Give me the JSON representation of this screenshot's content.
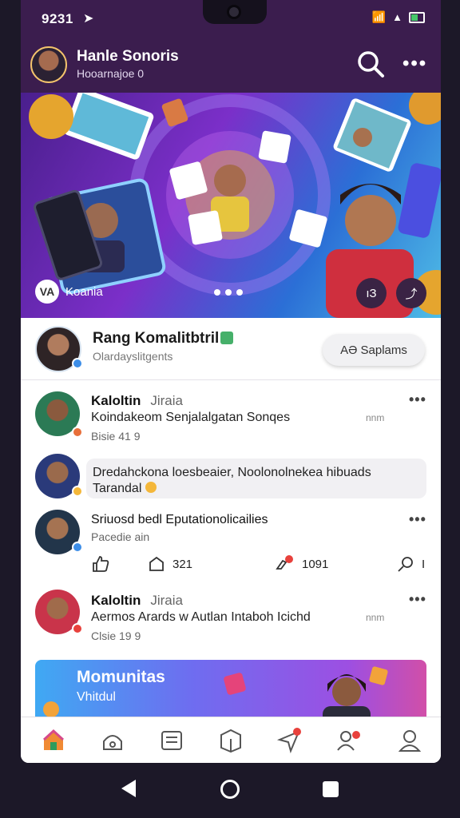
{
  "status_bar": {
    "time": "9231",
    "icons": [
      "location-arrow-icon",
      "wifi-icon",
      "signal-icon",
      "battery-icon"
    ]
  },
  "app_bar": {
    "title": "Hanle Sonoris",
    "subtitle": "Hooarnajoe 0",
    "search_icon": "search-icon",
    "more_icon": "more-icon",
    "more_label": "•••"
  },
  "hero": {
    "badge_logo": "VA",
    "badge_label": "Koania",
    "button_1": "ıЗ",
    "button_2": "⤴"
  },
  "profile_card": {
    "name": "Rang Komalitbtril",
    "subtitle": "Olardayslitgents",
    "button_label": "AƏ Saplams"
  },
  "feed": [
    {
      "name": "Kaloltin",
      "tag": "Jiraia",
      "line": "Koindakeom Senjalalgatan Sonqes",
      "meta": "Bisie 41 9",
      "time": "nnm"
    },
    {
      "bubble": "Dredahckona loesbeaier, Noolonolnekea hibuads",
      "bubble_line2": "Tarandal"
    },
    {
      "name": "Sriuosd bedl Eputationolicailies",
      "meta": "Pacedie ain"
    },
    {
      "name": "Kaloltin",
      "tag": "Jiraia",
      "line": "Aermos Arards w Autlan Intaboh Icichd",
      "meta": "Clsie 19 9",
      "time": "nnm"
    }
  ],
  "actions": {
    "like": "",
    "share_count": "321",
    "comment_count": "1091",
    "reply": "I"
  },
  "promo": {
    "title": "Momunitas",
    "subtitle": "Vhitdul"
  },
  "bottom_nav": [
    "home-icon",
    "explore-icon",
    "feed-icon",
    "box-icon",
    "send-icon",
    "friends-icon",
    "profile-icon"
  ],
  "colors": {
    "app_bar": "#3b1d4e",
    "accent": "#7b2fc9",
    "notification": "#e8413c"
  }
}
